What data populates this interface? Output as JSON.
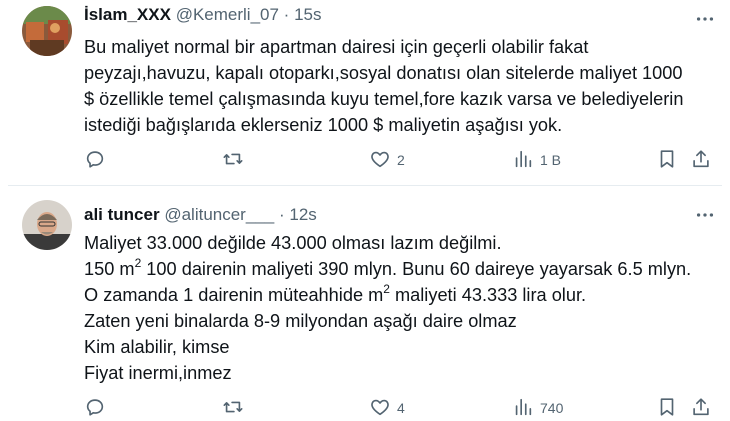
{
  "tweets": [
    {
      "name": "İslam_XXX",
      "handle": "@Kemerli_07",
      "separator": "·",
      "time": "15s",
      "lines": [
        "Bu maliyet normal bir apartman dairesi için geçerli olabilir fakat",
        "peyzajı,havuzu, kapalı otoparkı,sosyal donatısı olan sitelerde maliyet 1000",
        "$ özellikle temel çalışmasında kuyu temel,fore kazık varsa ve belediyelerin",
        "istediği bağışlarıda eklerseniz 1000 $ maliyetin aşağısı yok."
      ],
      "actions": {
        "replies": "",
        "retweets": "",
        "likes": "2",
        "views": "1 B"
      }
    },
    {
      "name": "ali tuncer",
      "handle": "@alituncer___",
      "separator": "·",
      "time": "12s",
      "lines": [
        "Maliyet 33.000 değilde 43.000 olması lazım değilmi.",
        {
          "pre": "150 m",
          "sup": "2",
          "post": " 100 dairenin maliyeti 390 mlyn. Bunu 60 daireye yayarsak 6.5 mlyn."
        },
        {
          "pre": "O zamanda 1 dairenin müteahhide m",
          "sup": "2",
          "post": " maliyeti 43.333 lira olur."
        },
        "Zaten yeni binalarda 8-9 milyondan aşağı daire olmaz",
        "Kim alabilir, kimse",
        "Fiyat inermi,inmez"
      ],
      "actions": {
        "replies": "",
        "retweets": "",
        "likes": "4",
        "views": "740"
      }
    }
  ],
  "icons": {
    "more": "more-horizontal-icon",
    "reply": "reply-icon",
    "retweet": "retweet-icon",
    "like": "heart-icon",
    "views": "views-bar-chart-icon",
    "bookmark": "bookmark-icon",
    "share": "share-icon"
  },
  "colors": {
    "text": "#0f1419",
    "muted": "#536471",
    "divider": "#e6ecf0"
  }
}
